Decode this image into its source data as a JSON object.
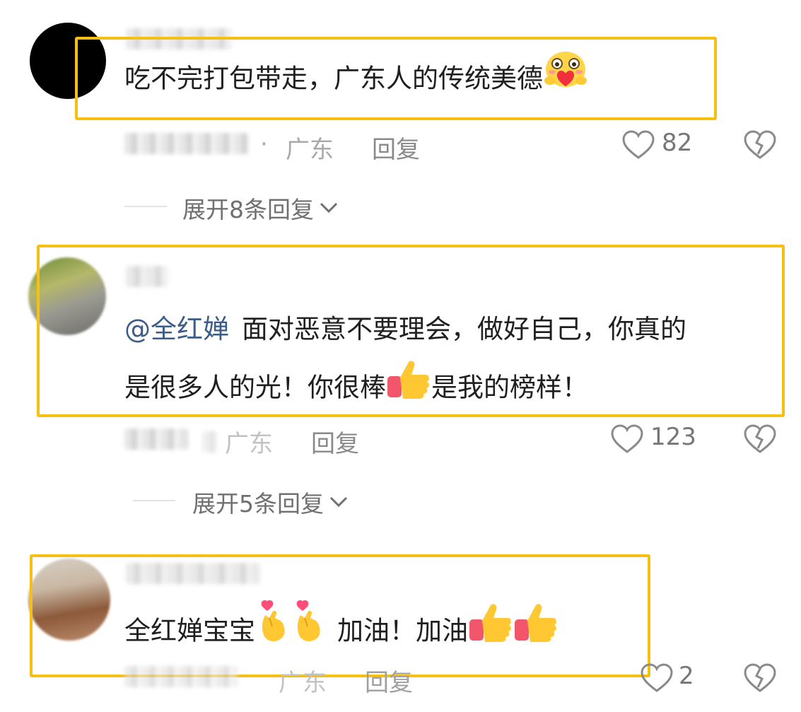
{
  "comments": [
    {
      "text": "吃不完打包带走，广东人的传统美德",
      "region": "广东",
      "reply_label": "回复",
      "likes": "82",
      "expand_label": "展开8条回复"
    },
    {
      "mention": "@全红婵",
      "text_line1": "面对恶意不要理会，做好自己，你真的",
      "text_line2a": "是很多人的光！你很棒",
      "text_line2b": "是我的榜样！",
      "region": "广东",
      "reply_label": "回复",
      "likes": "123",
      "expand_label": "展开5条回复"
    },
    {
      "text_a": "全红婵宝宝",
      "text_b": "加油！加油",
      "region": "广东",
      "reply_label": "回复",
      "likes": "2"
    }
  ],
  "separator": "·",
  "icons": {
    "like": "heart-outline-icon",
    "dislike": "broken-heart-icon",
    "expand": "chevron-down-icon"
  },
  "colors": {
    "highlight": "#f6bf14",
    "mention": "#3a5c86"
  }
}
